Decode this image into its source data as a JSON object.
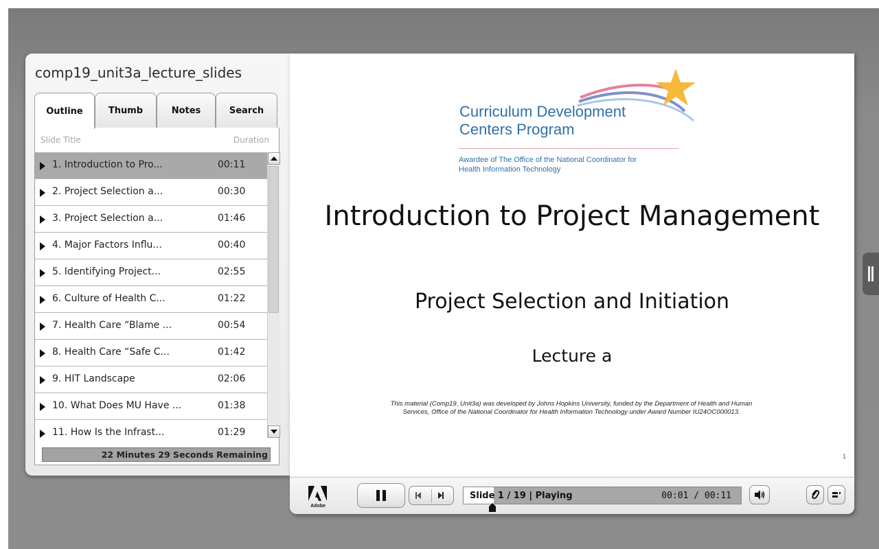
{
  "deck": {
    "title": "comp19_unit3a_lecture_slides"
  },
  "tabs": [
    "Outline",
    "Thumb",
    "Notes",
    "Search"
  ],
  "outline": {
    "header_title": "Slide Title",
    "header_duration": "Duration",
    "rows": [
      {
        "title": "1. Introduction to Pro...",
        "duration": "00:11"
      },
      {
        "title": "2. Project Selection a...",
        "duration": "00:30"
      },
      {
        "title": "3. Project Selection a...",
        "duration": "01:46"
      },
      {
        "title": "4. Major Factors Influ...",
        "duration": "00:40"
      },
      {
        "title": "5. Identifying Project...",
        "duration": "02:55"
      },
      {
        "title": "6. Culture of Health C...",
        "duration": "01:22"
      },
      {
        "title": "7. Health Care “Blame ...",
        "duration": "00:54"
      },
      {
        "title": "8. Health Care “Safe C...",
        "duration": "01:42"
      },
      {
        "title": "9. HIT Landscape",
        "duration": "02:06"
      },
      {
        "title": "10. What Does MU Have ...",
        "duration": "01:38"
      },
      {
        "title": "11. How Is the Infrast...",
        "duration": "01:29"
      }
    ],
    "remaining": "22 Minutes 29 Seconds Remaining"
  },
  "slide": {
    "org_line1": "Curriculum Development",
    "org_line2": "Centers Program",
    "award_line1": "Awardee of The Office of the National Coordinator for",
    "award_line2": "Health Information Technology",
    "title": "Introduction to Project Management",
    "subtitle": "Project Selection and Initiation",
    "lecture": "Lecture a",
    "disclaimer_line1": "This material (Comp19_Unit3a) was developed by Johns Hopkins University, funded by the Department of Health and Human",
    "disclaimer_line2": "Services, Office of the National Coordinator for Health Information Technology under Award Number IU24OC000013.",
    "page_number": "1"
  },
  "player": {
    "status": "Slide 1 / 19 | Playing",
    "time": "00:01 / 00:11",
    "logo_text": "Adobe",
    "slide_progress_fraction": 0.11
  },
  "colors": {
    "accent_blue": "#2f6fa8",
    "star": "#f6b93b"
  }
}
